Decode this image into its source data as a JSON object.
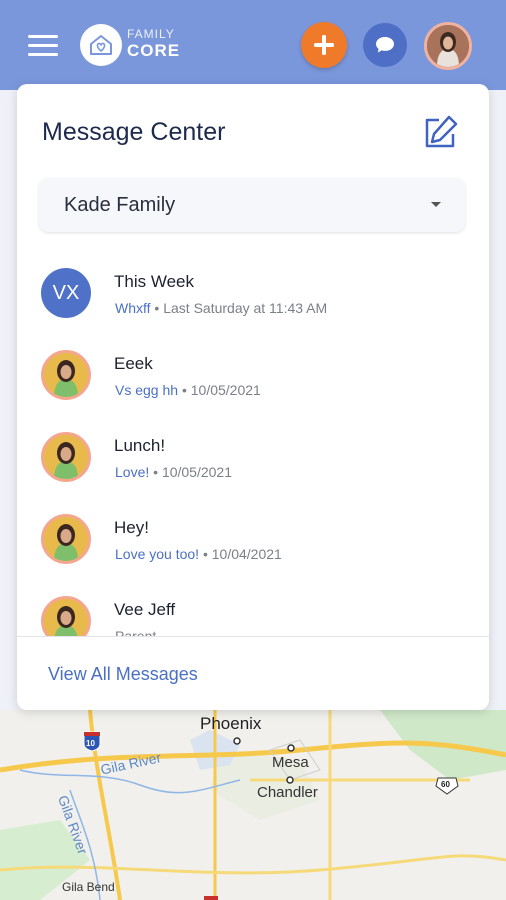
{
  "header": {
    "logo_line1": "FAMILY",
    "logo_line2": "CORE",
    "add_icon": "plus-icon",
    "chat_icon": "chat-bubble-icon",
    "brand_color": "#7b97dc",
    "accent_color": "#ef7a2a"
  },
  "message_center": {
    "title": "Message Center",
    "family_select": {
      "value": "Kade Family"
    },
    "messages": [
      {
        "initials": "VX",
        "subject": "This Week",
        "preview": "Whxff",
        "time": "Last Saturday at 11:43 AM"
      },
      {
        "subject": "Eeek",
        "preview": "Vs egg hh",
        "time": "10/05/2021"
      },
      {
        "subject": "Lunch!",
        "preview": "Love!",
        "time": "10/05/2021"
      },
      {
        "subject": "Hey!",
        "preview": "Love you too!",
        "time": "10/04/2021"
      },
      {
        "subject": "Vee Jeff",
        "preview": "",
        "time": "Parent"
      }
    ],
    "view_all": "View All Messages"
  },
  "map": {
    "places": [
      "Phoenix",
      "Mesa",
      "Chandler",
      "Gila River",
      "Gila River",
      "Gila Bend"
    ],
    "shields": [
      "10",
      "60"
    ]
  }
}
